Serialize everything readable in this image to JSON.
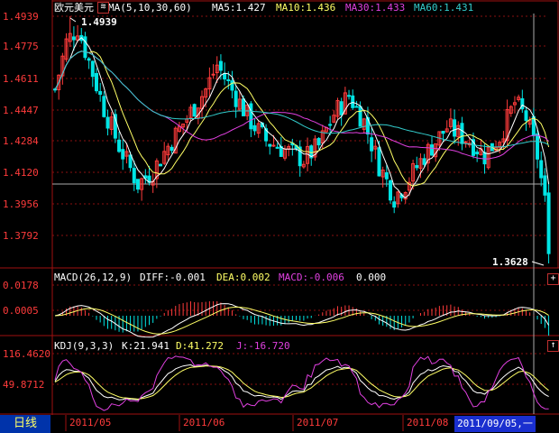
{
  "panel_title": "欧元美元",
  "ma_header": {
    "label": "MA(5,10,30,60)",
    "ma5": "MA5:1.427",
    "ma10": "MA10:1.436",
    "ma30": "MA30:1.433",
    "ma60": "MA60:1.431"
  },
  "macd_header": {
    "label": "MACD(26,12,9)",
    "diff": "DIFF:-0.001",
    "dea": "DEA:0.002",
    "macd": "MACD:-0.006",
    "extra": "0.000"
  },
  "kdj_header": {
    "label": "KDJ(9,3,3)",
    "k": "K:21.941",
    "d": "D:41.272",
    "j": "J:-16.720"
  },
  "price_axis_labels": [
    "1.4939",
    "1.4775",
    "1.4611",
    "1.4447",
    "1.4284",
    "1.4120",
    "1.3956",
    "1.3792"
  ],
  "macd_axis_labels": [
    "0.0178",
    "0.0005"
  ],
  "kdj_axis_labels": [
    "116.4620",
    "49.8712"
  ],
  "high_label": "1.4939",
  "low_label": "1.3628",
  "date_labels": [
    "2011/05",
    "2011/06",
    "2011/07",
    "2011/08"
  ],
  "period_tab": "日线",
  "cursor_date": "2011/09/05,一",
  "colors": {
    "up": "#ff3b3b",
    "down": "#00e5e5",
    "ma5": "#ffffff",
    "ma10": "#ffff66",
    "ma30": "#e040e0",
    "ma60": "#33cccc",
    "axis": "#a01010"
  },
  "chart_data": {
    "type": "candlestick",
    "price_range": [
      1.3628,
      1.4939
    ],
    "candles": [],
    "macd_range": [
      -0.008,
      0.022
    ],
    "kdj_range": [
      -20,
      130
    ]
  }
}
